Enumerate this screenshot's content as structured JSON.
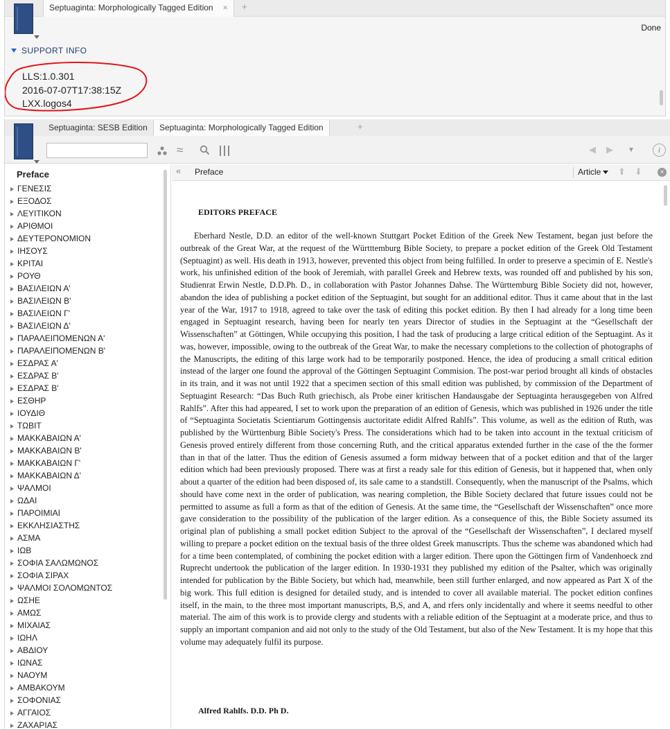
{
  "top_panel": {
    "tab_label": "Septuaginta: Morphologically Tagged Edition",
    "tab_close": "×",
    "new_tab": "+",
    "done_label": "Done",
    "support_header": "SUPPORT INFO",
    "support_lines": [
      "LLS:1.0.301",
      "2016-07-07T17:38:15Z",
      "LXX.logos4"
    ],
    "annotation_color": "#e3151a"
  },
  "bottom_panel": {
    "tabs": [
      {
        "label": "Septuaginta: SESB Edition"
      },
      {
        "label": "Septuaginta: Morphologically Tagged Edition"
      }
    ],
    "new_tab": "+",
    "search_placeholder": "",
    "toolbar_icons": [
      "dots-icon",
      "approx-icon",
      "search-icon",
      "columns-icon"
    ],
    "info_glyph": "i"
  },
  "sidebar": {
    "title": "Preface",
    "items": [
      "ΓΕΝΕΣΙΣ",
      "ΕΞΟΔΟΣ",
      "ΛΕΥΙΤΙΚΟΝ",
      "ΑΡΙΘΜΟΙ",
      "ΔΕΥΤΕΡΟΝΟΜΙΟΝ",
      "ΙΗΣΟΥΣ",
      "ΚΡΙΤΑΙ",
      "ΡΟΥΘ",
      "ΒΑΣΙΛΕΙΩΝ Α'",
      "ΒΑΣΙΛΕΙΩΝ Β'",
      "ΒΑΣΙΛΕΙΩΝ Γ'",
      "ΒΑΣΙΛΕΙΩΝ Δ'",
      "ΠΑΡΑΛΕΙΠΟΜΕΝΩΝ Α'",
      "ΠΑΡΑΛΕΙΠΟΜΕΝΩΝ Β'",
      "ΕΣΔΡΑΣ Α'",
      "ΕΣΔΡΑΣ Β'",
      "ΕΣΔΡΑΣ Β'",
      "ΕΣΘΗΡ",
      "ΙΟΥΔΙΘ",
      "ΤΩΒΙΤ",
      "ΜΑΚΚΑΒΑΙΩΝ Α'",
      "ΜΑΚΚΑΒΑΙΩΝ Β'",
      "ΜΑΚΚΑΒΑΙΩΝ Γ'",
      "ΜΑΚΚΑΒΑΙΩΝ Δ'",
      "ΨΑΛΜΟΙ",
      "ΩΔΑΙ",
      "ΠΑΡΟΙΜΙΑΙ",
      "ΕΚΚΛΗΣΙΑΣΤΗΣ",
      "ΑΣΜΑ",
      "ΙΩΒ",
      "ΣΟΦΙΑ ΣΑΛΩΜΩΝΟΣ",
      "ΣΟΦΙΑ ΣΙΡΑΧ",
      "ΨΑΛΜΟΙ ΣΟΛΟΜΩΝΤΟΣ",
      "ΩΣΗΕ",
      "ΑΜΩΣ",
      "ΜΙΧΑΙΑΣ",
      "ΙΩΗΛ",
      "ΑΒΔΙΟΥ",
      "ΙΩΝΑΣ",
      "ΝΑΟΥΜ",
      "ΑΜΒΑΚΟΥΜ",
      "ΣΟΦΟΝΙΑΣ",
      "ΑΓΓΑΙΟΣ",
      "ΖΑΧΑΡΙΑΣ"
    ]
  },
  "content": {
    "collapse_glyph": "«",
    "header_title": "Preface",
    "article_menu": "Article",
    "title": "EDITORS PREFACE",
    "body": "Eberhard Nestle, D.D. an editor of the well-known Stuttgart Pocket Edition of the Greek New Testament, began just before the outbreak of the Great War, at the request of the Württtemburg Bible Society, to prepare a pocket edition of the Greek Old Testament (Septuagint) as well. His death in 1913, however, prevented this object from being fulfilled. In order to preserve a specimin of E. Nestle's work, his unfinished edition of the book of Jeremiah, with parallel Greek and Hebrew texts, was rounded off and published by his son, Studienrat Erwin Nestle, D.D.Ph. D., in collaboration with Pastor Johannes Dahse. The Württemburg Bible Society did not, however, abandon the idea of publishing a pocket edition of the Septuagint, but sought for an additional editor. Thus it came about that in the last year of the War, 1917 to 1918, agreed to take over the task of editing this pocket edition. By then I had already for a long time been engaged in Septuagint research, having been for nearly ten years Director of studies in the Septuagint at the “Gesellschaft der Wissenschaften” at Göttingen, While occupying this position, I had the task of producing a large critical edition of the Septuagint. As it was, however, impossible, owing to the outbreak of the Great War, to make the necessary completions to the collection of photographs of the Manuscripts, the editing of this large work had to be temporarily postponed. Hence, the idea of producing a small critical edition instead of the larger one found the approval of the Göttingen Septuagint Commision. The post-war period brought all kinds of obstacles in its train, and it was not until 1922 that a specimen section of this small edition was published, by commission of the Department of Septuagint Research: “Das Buch Ruth griechisch, als Probe einer kritischen Handausgabe der Septuaginta herausgegeben von Alfred Rahlfs”. After this had appeared, I set to work upon the preparation of an edition of Genesis, which was published in 1926 under the title of “Septuaginta Societatis Scientiarum Gottingensis auctoritate edidit Alfred Rahlfs”. This volume, as well as the edition of Ruth, was published by the Württenburg Bible Society's Press. The considerations which had to be taken into account in the textual criticism of Genesis proved entirely different from those concerning Ruth, and the critical apparatus extended further in the case of the the former than in that of the latter. Thus the edition of Genesis assumed a form midway between that of a pocket edition and that of the larger edition which had been previously proposed. There was at first a ready sale for this edition of Genesis, but it happened that, when only about a quarter of the edition had been disposed of, its sale came to a standstill. Consequently, when the manuscript of the Psalms, which should have come next in the order of publication, was nearing completion, the Bible Society declared that future issues could not be permitted to assume as full a form as that of the edition of Genesis. At the same time, the “Gesellschaft der Wissenschaften” once more gave consideration to the possibility of the publication of the larger edition. As a consequence of this, the Bible Society assumed its original plan of publishing a small pocket edition Subject to the aproval of the “Gesellschaft der Wissenschaften”, I declared myself willing to prepare a pocket edition on the textual basis of the three oldest Greek manuscripts. Thus the scheme was abandoned which had for a time been contemplated, of combining the pocket edition with a larger edition. There upon the Göttingen firm of Vandenhoeck znd Ruprecht undertook the publication of the larger edition. In 1930-1931 they published my edition of the Psalter, which was originally intended for publication by the Bible Society, but which had, meanwhile, been still further enlarged, and now appeared as Part X of the big work. This full edition is designed for detailed study, and is intended to cover all available material. The pocket edition confines itself, in the main, to the three most important manuscripts, B,S, and A, and rfers only incidentally and where it seems needful to other material. The aim of this work is to provide clergy and students with a reliable edition of the Septuagint at a moderate price, and thus to supply an important companion and aid not only to the study of the Old Testament, but also of the New Testament. It is my hope that this volume may adequately fulfil its purpose.",
    "signature": "Alfred Rahlfs. D.D. Ph D."
  }
}
